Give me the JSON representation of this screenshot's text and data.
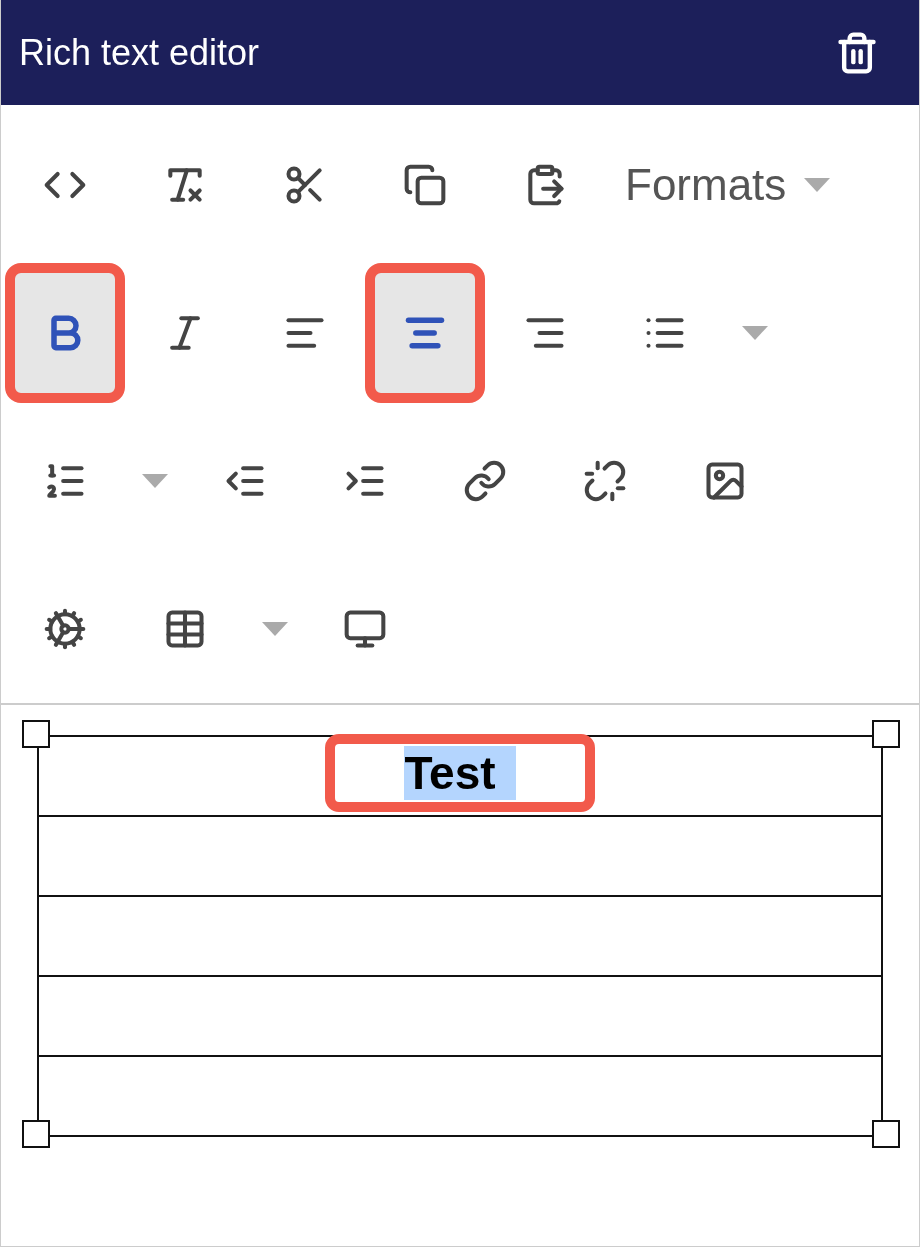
{
  "header": {
    "title": "Rich text editor"
  },
  "toolbar": [
    [
      {
        "kind": "button",
        "active": false,
        "marked": false
      },
      {
        "kind": "button",
        "active": false,
        "marked": false
      },
      {
        "kind": "button",
        "active": false,
        "marked": false
      },
      {
        "kind": "button",
        "active": false,
        "marked": false
      },
      {
        "kind": "button",
        "active": false,
        "marked": false
      },
      {
        "kind": "menu",
        "label": "Formats"
      }
    ],
    [
      {
        "kind": "button",
        "active": true,
        "marked": true
      },
      {
        "kind": "button",
        "active": false,
        "marked": false
      },
      {
        "kind": "button",
        "active": false,
        "marked": false
      },
      {
        "kind": "button",
        "active": true,
        "marked": true
      },
      {
        "kind": "button",
        "active": false,
        "marked": false
      },
      {
        "kind": "split",
        "active": false,
        "marked": false
      }
    ],
    [
      {
        "kind": "split",
        "active": false,
        "marked": false
      },
      {
        "kind": "button",
        "active": false,
        "marked": false
      },
      {
        "kind": "button",
        "active": false,
        "marked": false
      },
      {
        "kind": "button",
        "active": false,
        "marked": false
      },
      {
        "kind": "button",
        "active": false,
        "marked": false
      },
      {
        "kind": "button",
        "active": false,
        "marked": false
      }
    ],
    [
      {
        "kind": "button",
        "active": false,
        "marked": false
      },
      {
        "kind": "split",
        "active": false,
        "marked": false
      },
      {
        "kind": "button",
        "active": false,
        "marked": false
      }
    ]
  ],
  "table": {
    "rows": [
      {
        "text": "Test",
        "selected": true,
        "marked": true
      },
      {
        "marked": false
      },
      {
        "marked": false
      },
      {
        "marked": false
      },
      {
        "marked": false
      }
    ]
  }
}
